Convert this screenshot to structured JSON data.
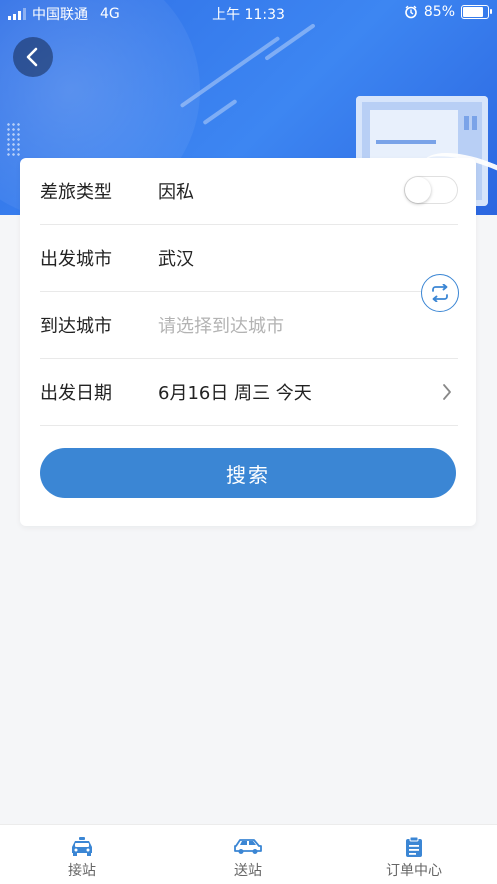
{
  "status_bar": {
    "carrier": "中国联通",
    "network": "4G",
    "time": "上午 11:33",
    "battery": "85%"
  },
  "icons": {
    "back": "chevron-left-icon",
    "swap": "swap-icon",
    "chevron": "chevron-right-icon",
    "alarm": "alarm-icon",
    "battery": "battery-icon",
    "signal": "signal-icon"
  },
  "form": {
    "travel_type": {
      "label": "差旅类型",
      "value": "因私",
      "toggle_on": false
    },
    "departure_city": {
      "label": "出发城市",
      "value": "武汉"
    },
    "arrival_city": {
      "label": "到达城市",
      "placeholder": "请选择到达城市"
    },
    "departure_date": {
      "label": "出发日期",
      "value": "6月16日 周三 今天"
    },
    "search_button": "搜索"
  },
  "tabbar": {
    "items": [
      {
        "label": "接站",
        "icon": "taxi-icon"
      },
      {
        "label": "送站",
        "icon": "car-icon"
      },
      {
        "label": "订单中心",
        "icon": "clipboard-icon"
      }
    ]
  },
  "colors": {
    "primary": "#3b86d4",
    "hero_blue": "#3d86f2",
    "placeholder": "#b3b3b3"
  }
}
